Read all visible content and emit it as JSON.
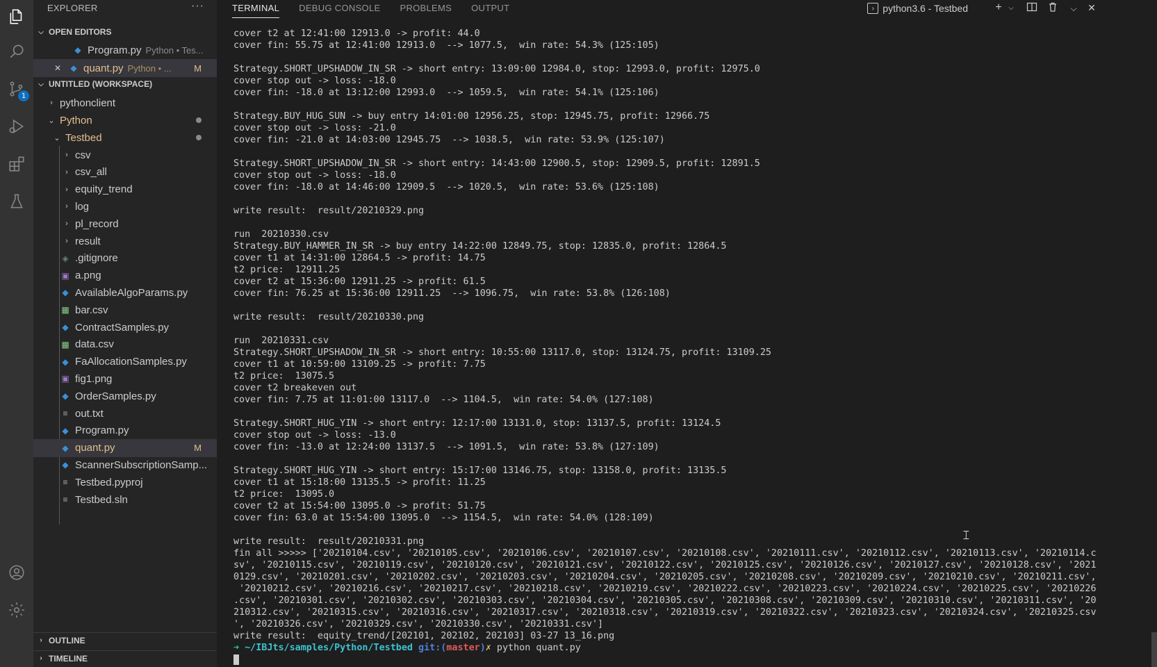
{
  "explorer": {
    "title": "EXPLORER",
    "more": "···",
    "open_editors": {
      "label": "OPEN EDITORS",
      "items": [
        {
          "name": "Program.py",
          "desc": "Python • Tes..."
        },
        {
          "name": "quant.py",
          "desc": "Python • ...",
          "status": "M",
          "close": "✕"
        }
      ]
    },
    "workspace": {
      "label": "UNTITLED (WORKSPACE)",
      "folders": {
        "pythonclient": "pythonclient",
        "python": "Python",
        "testbed": "Testbed"
      },
      "testbed_children": [
        {
          "type": "folder",
          "name": "csv"
        },
        {
          "type": "folder",
          "name": "csv_all"
        },
        {
          "type": "folder",
          "name": "equity_trend"
        },
        {
          "type": "folder",
          "name": "log"
        },
        {
          "type": "folder",
          "name": "pl_record"
        },
        {
          "type": "folder",
          "name": "result"
        },
        {
          "type": "git",
          "name": ".gitignore"
        },
        {
          "type": "img",
          "name": "a.png"
        },
        {
          "type": "py",
          "name": "AvailableAlgoParams.py"
        },
        {
          "type": "csv",
          "name": "bar.csv"
        },
        {
          "type": "py",
          "name": "ContractSamples.py"
        },
        {
          "type": "csv",
          "name": "data.csv"
        },
        {
          "type": "py",
          "name": "FaAllocationSamples.py"
        },
        {
          "type": "img",
          "name": "fig1.png"
        },
        {
          "type": "py",
          "name": "OrderSamples.py"
        },
        {
          "type": "txt",
          "name": "out.txt"
        },
        {
          "type": "py",
          "name": "Program.py"
        },
        {
          "type": "py",
          "name": "quant.py",
          "status": "M"
        },
        {
          "type": "py",
          "name": "ScannerSubscriptionSamp..."
        },
        {
          "type": "txt",
          "name": "Testbed.pyproj"
        },
        {
          "type": "txt",
          "name": "Testbed.sln"
        }
      ]
    },
    "outline": "OUTLINE",
    "timeline": "TIMELINE"
  },
  "activity": {
    "scm_badge": "1"
  },
  "panel": {
    "tabs": [
      "TERMINAL",
      "DEBUG CONSOLE",
      "PROBLEMS",
      "OUTPUT"
    ],
    "terminal_name": "python3.6 - Testbed"
  },
  "terminal": {
    "lines": [
      "cover t2 at 12:41:00 12913.0 -> profit: 44.0",
      "cover fin: 55.75 at 12:41:00 12913.0  --> 1077.5,  win rate: 54.3% (125:105)",
      "",
      "Strategy.SHORT_UPSHADOW_IN_SR -> short entry: 13:09:00 12984.0, stop: 12993.0, profit: 12975.0",
      "cover stop out -> loss: -18.0",
      "cover fin: -18.0 at 13:12:00 12993.0  --> 1059.5,  win rate: 54.1% (125:106)",
      "",
      "Strategy.BUY_HUG_SUN -> buy entry 14:01:00 12956.25, stop: 12945.75, profit: 12966.75",
      "cover stop out -> loss: -21.0",
      "cover fin: -21.0 at 14:03:00 12945.75  --> 1038.5,  win rate: 53.9% (125:107)",
      "",
      "Strategy.SHORT_UPSHADOW_IN_SR -> short entry: 14:43:00 12900.5, stop: 12909.5, profit: 12891.5",
      "cover stop out -> loss: -18.0",
      "cover fin: -18.0 at 14:46:00 12909.5  --> 1020.5,  win rate: 53.6% (125:108)",
      "",
      "write result:  result/20210329.png",
      "",
      "run  20210330.csv",
      "Strategy.BUY_HAMMER_IN_SR -> buy entry 14:22:00 12849.75, stop: 12835.0, profit: 12864.5",
      "cover t1 at 14:31:00 12864.5 -> profit: 14.75",
      "t2 price:  12911.25",
      "cover t2 at 15:36:00 12911.25 -> profit: 61.5",
      "cover fin: 76.25 at 15:36:00 12911.25  --> 1096.75,  win rate: 53.8% (126:108)",
      "",
      "write result:  result/20210330.png",
      "",
      "run  20210331.csv",
      "Strategy.SHORT_UPSHADOW_IN_SR -> short entry: 10:55:00 13117.0, stop: 13124.75, profit: 13109.25",
      "cover t1 at 10:59:00 13109.25 -> profit: 7.75",
      "t2 price:  13075.5",
      "cover t2 breakeven out",
      "cover fin: 7.75 at 11:01:00 13117.0  --> 1104.5,  win rate: 54.0% (127:108)",
      "",
      "Strategy.SHORT_HUG_YIN -> short entry: 12:17:00 13131.0, stop: 13137.5, profit: 13124.5",
      "cover stop out -> loss: -13.0",
      "cover fin: -13.0 at 12:24:00 13137.5  --> 1091.5,  win rate: 53.8% (127:109)",
      "",
      "Strategy.SHORT_HUG_YIN -> short entry: 15:17:00 13146.75, stop: 13158.0, profit: 13135.5",
      "cover t1 at 15:18:00 13135.5 -> profit: 11.25",
      "t2 price:  13095.0",
      "cover t2 at 15:54:00 13095.0 -> profit: 51.75",
      "cover fin: 63.0 at 15:54:00 13095.0  --> 1154.5,  win rate: 54.0% (128:109)",
      "",
      "write result:  result/20210331.png",
      "fin all >>>>> ['20210104.csv', '20210105.csv', '20210106.csv', '20210107.csv', '20210108.csv', '20210111.csv', '20210112.csv', '20210113.csv', '20210114.c",
      "sv', '20210115.csv', '20210119.csv', '20210120.csv', '20210121.csv', '20210122.csv', '20210125.csv', '20210126.csv', '20210127.csv', '20210128.csv', '2021",
      "0129.csv', '20210201.csv', '20210202.csv', '20210203.csv', '20210204.csv', '20210205.csv', '20210208.csv', '20210209.csv', '20210210.csv', '20210211.csv',",
      " '20210212.csv', '20210216.csv', '20210217.csv', '20210218.csv', '20210219.csv', '20210222.csv', '20210223.csv', '20210224.csv', '20210225.csv', '20210226",
      ".csv', '20210301.csv', '20210302.csv', '20210303.csv', '20210304.csv', '20210305.csv', '20210308.csv', '20210309.csv', '20210310.csv', '20210311.csv', '20",
      "210312.csv', '20210315.csv', '20210316.csv', '20210317.csv', '20210318.csv', '20210319.csv', '20210322.csv', '20210323.csv', '20210324.csv', '20210325.csv",
      "', '20210326.csv', '20210329.csv', '20210330.csv', '20210331.csv']",
      "write result:  equity_trend/[202101, 202102, 202103] 03-27 13_16.png"
    ],
    "prompt": {
      "arrow": "➜",
      "dir": "~/IBJts/samples/Python/Testbed",
      "git": "git:(",
      "branch": "master",
      "git_close": ")",
      "dirty": "✗",
      "command": "python quant.py"
    }
  }
}
